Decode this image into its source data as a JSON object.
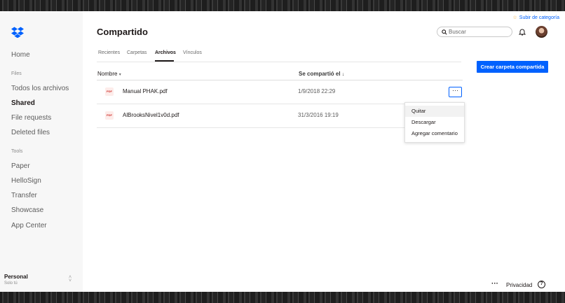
{
  "header": {
    "upgrade_link": "Subir de categoría",
    "title": "Compartido",
    "search_placeholder": "Buscar"
  },
  "sidebar": {
    "section_files": "Files",
    "section_tools": "Tools",
    "items": [
      {
        "label": "Home"
      },
      {
        "label": "Todos los archivos"
      },
      {
        "label": "Shared"
      },
      {
        "label": "File requests"
      },
      {
        "label": "Deleted files"
      },
      {
        "label": "Paper"
      },
      {
        "label": "HelloSign"
      },
      {
        "label": "Transfer"
      },
      {
        "label": "Showcase"
      },
      {
        "label": "App Center"
      }
    ],
    "account": {
      "name": "Personal",
      "subtitle": "Solo tú"
    }
  },
  "tabs": [
    {
      "label": "Recientes"
    },
    {
      "label": "Carpetas"
    },
    {
      "label": "Archivos"
    },
    {
      "label": "Vínculos"
    }
  ],
  "active_tab": "Archivos",
  "create_button": "Crear carpeta compartida",
  "table": {
    "columns": [
      "Nombre",
      "Se compartió el"
    ],
    "rows": [
      {
        "name": "Manual PHAK.pdf",
        "date": "1/9/2018 22:29",
        "type": "PDF"
      },
      {
        "name": "AlBrooksNivel1v0d.pdf",
        "date": "31/3/2016 19:19",
        "type": "PDF"
      }
    ]
  },
  "context_menu": [
    {
      "label": "Quitar"
    },
    {
      "label": "Descargar"
    },
    {
      "label": "Agregar comentario"
    }
  ],
  "footer": {
    "privacy": "Privacidad",
    "help": "?"
  },
  "colors": {
    "accent": "#0061fe",
    "sidebar_bg": "#f7f7f7"
  }
}
